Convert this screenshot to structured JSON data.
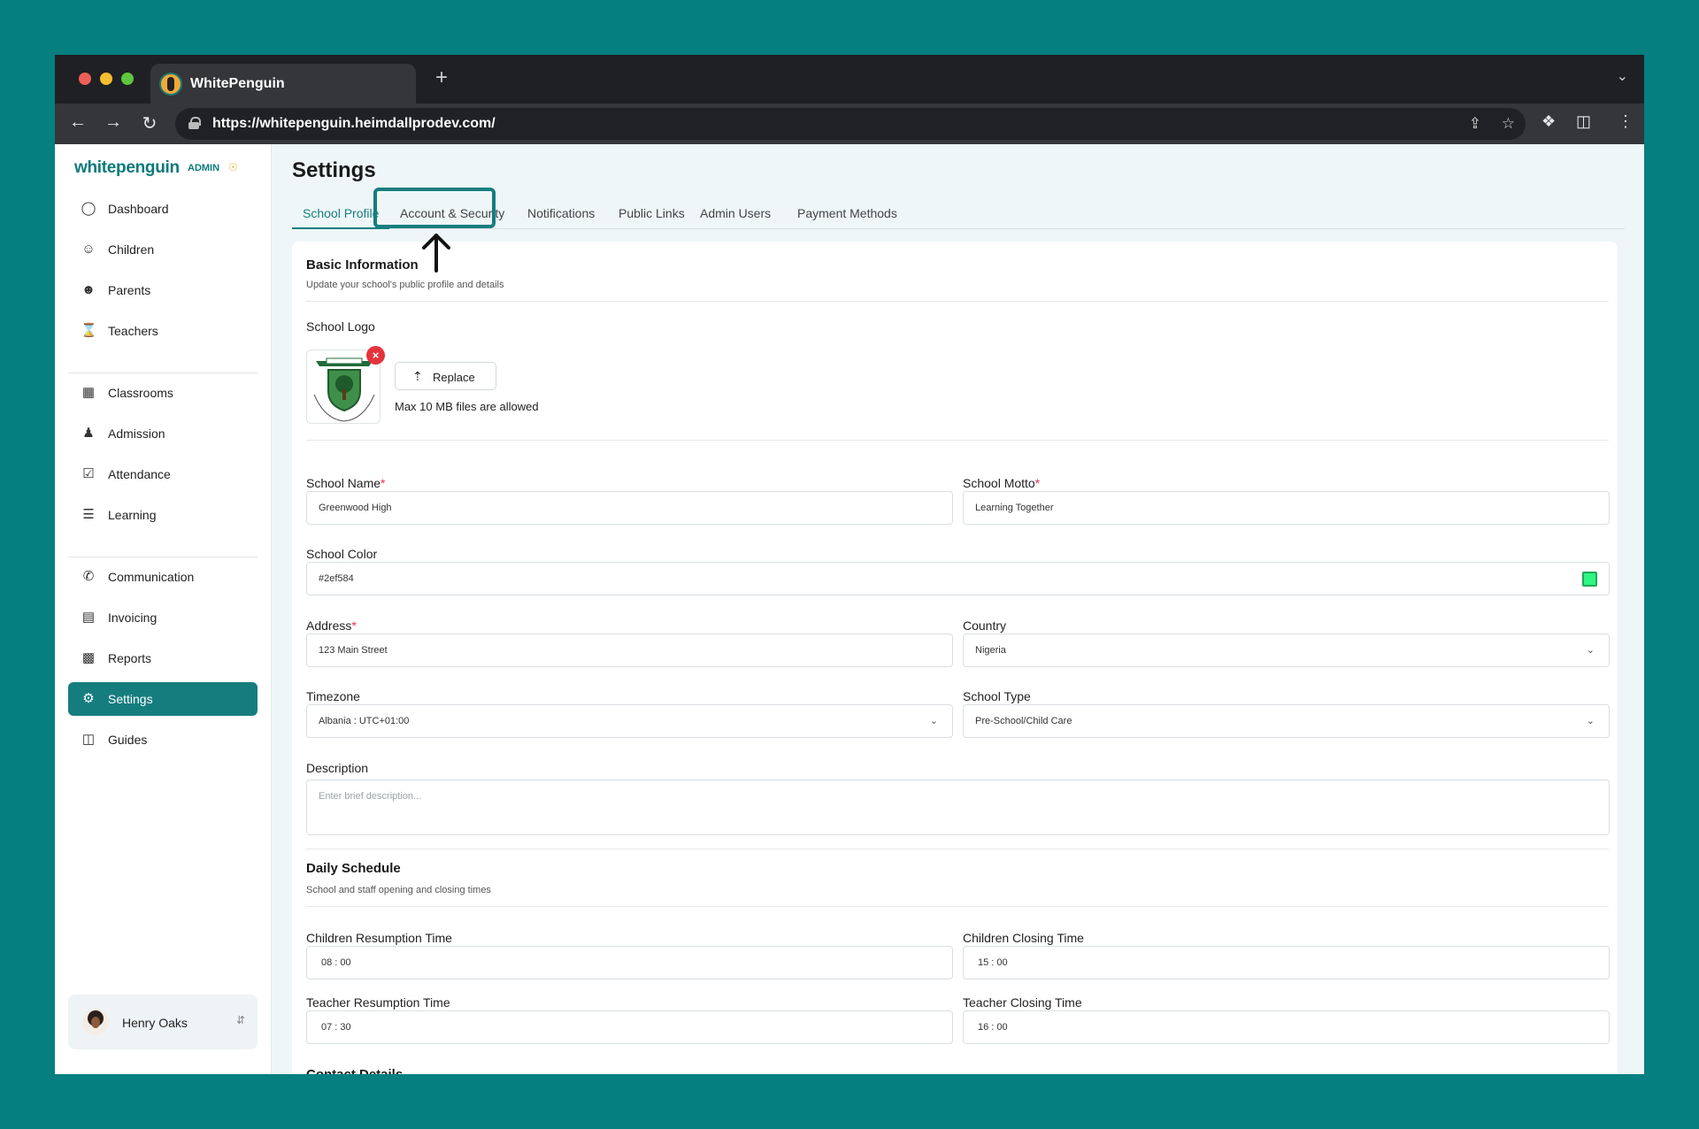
{
  "browser": {
    "tab_title": "WhitePenguin",
    "new_tab": "+",
    "url": "https://whitepenguin.heimdallprodev.com/"
  },
  "brand": {
    "logo_text": "whitepenguin",
    "admin_tag": "ADMIN",
    "accent_color": "#167d7f"
  },
  "sidebar": {
    "items": [
      {
        "label": "Dashboard",
        "icon": "dashboard-icon"
      },
      {
        "label": "Children",
        "icon": "children-icon"
      },
      {
        "label": "Parents",
        "icon": "parents-icon"
      },
      {
        "label": "Teachers",
        "icon": "teachers-icon"
      },
      {
        "label": "Classrooms",
        "icon": "classrooms-icon"
      },
      {
        "label": "Admission",
        "icon": "admission-icon"
      },
      {
        "label": "Attendance",
        "icon": "attendance-icon"
      },
      {
        "label": "Learning",
        "icon": "learning-icon"
      },
      {
        "label": "Communication",
        "icon": "communication-icon"
      },
      {
        "label": "Invoicing",
        "icon": "invoicing-icon"
      },
      {
        "label": "Reports",
        "icon": "reports-icon"
      },
      {
        "label": "Settings",
        "icon": "settings-icon",
        "active": true
      },
      {
        "label": "Guides",
        "icon": "guides-icon"
      }
    ],
    "user": {
      "name": "Henry Oaks"
    }
  },
  "page": {
    "title": "Settings",
    "tabs": [
      "School Profile",
      "Account & Security",
      "Notifications",
      "Public Links",
      "Admin Users",
      "Payment Methods"
    ],
    "active_tab": "School Profile"
  },
  "basic_info": {
    "title": "Basic Information",
    "subtitle": "Update your school's public profile and details",
    "logo_label": "School Logo",
    "replace_label": "Replace",
    "max_note": "Max 10 MB files are allowed",
    "school_name_label": "School Name",
    "school_name_value": "Greenwood High",
    "school_motto_label": "School Motto",
    "school_motto_value": "Learning Together",
    "school_color_label": "School Color",
    "school_color_value": "#2ef584",
    "address_label": "Address",
    "address_value": "123 Main Street",
    "country_label": "Country",
    "country_value": "Nigeria",
    "timezone_label": "Timezone",
    "timezone_value": "Albania : UTC+01:00",
    "school_type_label": "School Type",
    "school_type_value": "Pre-School/Child Care",
    "description_label": "Description",
    "description_placeholder": "Enter brief description..."
  },
  "daily_schedule": {
    "title": "Daily Schedule",
    "subtitle": "School and staff opening and closing times",
    "children_resumption_label": "Children Resumption Time",
    "children_resumption_value": "08 : 00",
    "children_closing_label": "Children Closing Time",
    "children_closing_value": "15 : 00",
    "teacher_resumption_label": "Teacher Resumption Time",
    "teacher_resumption_value": "07 : 30",
    "teacher_closing_label": "Teacher Closing Time",
    "teacher_closing_value": "16 : 00"
  },
  "contact_details": {
    "title": "Contact Details"
  }
}
